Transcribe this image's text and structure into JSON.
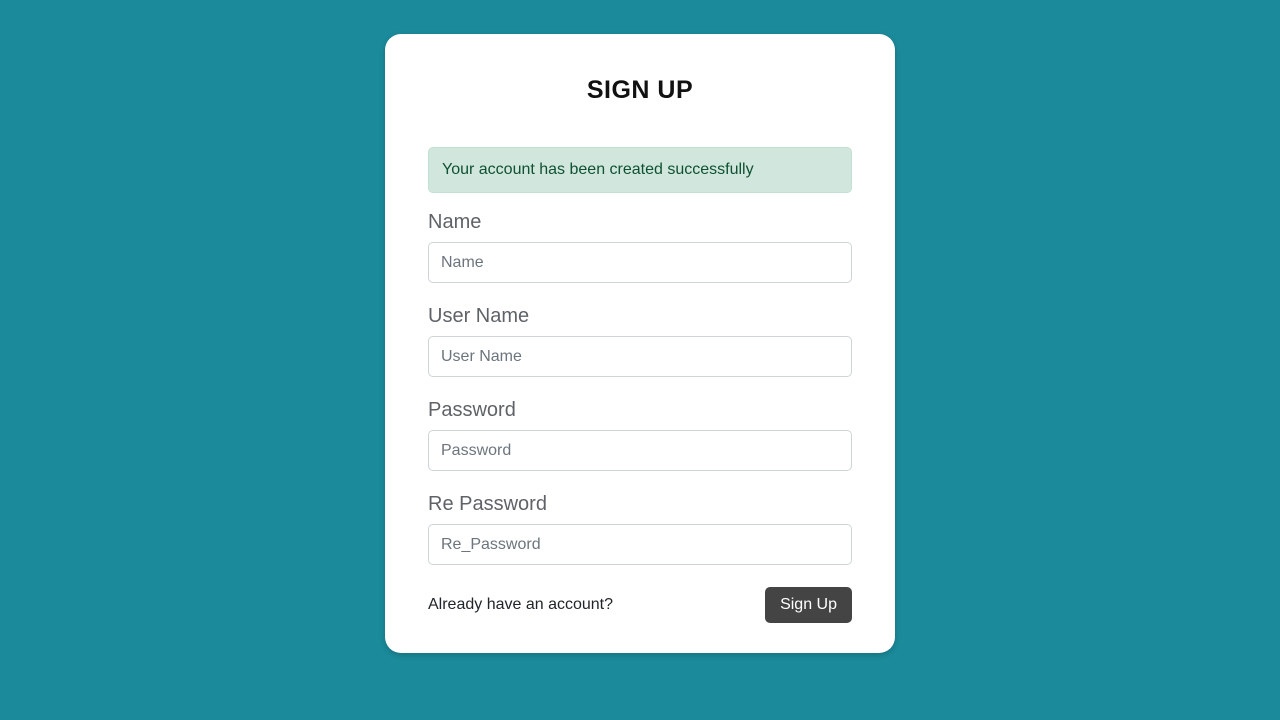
{
  "form": {
    "title": "SIGN UP",
    "alert": "Your account has been created successfully",
    "fields": {
      "name": {
        "label": "Name",
        "placeholder": "Name",
        "value": ""
      },
      "username": {
        "label": "User Name",
        "placeholder": "User Name",
        "value": ""
      },
      "password": {
        "label": "Password",
        "placeholder": "Password",
        "value": ""
      },
      "repassword": {
        "label": "Re Password",
        "placeholder": "Re_Password",
        "value": ""
      }
    },
    "footer": {
      "login_prompt": "Already have an account?",
      "submit_label": "Sign Up"
    }
  }
}
